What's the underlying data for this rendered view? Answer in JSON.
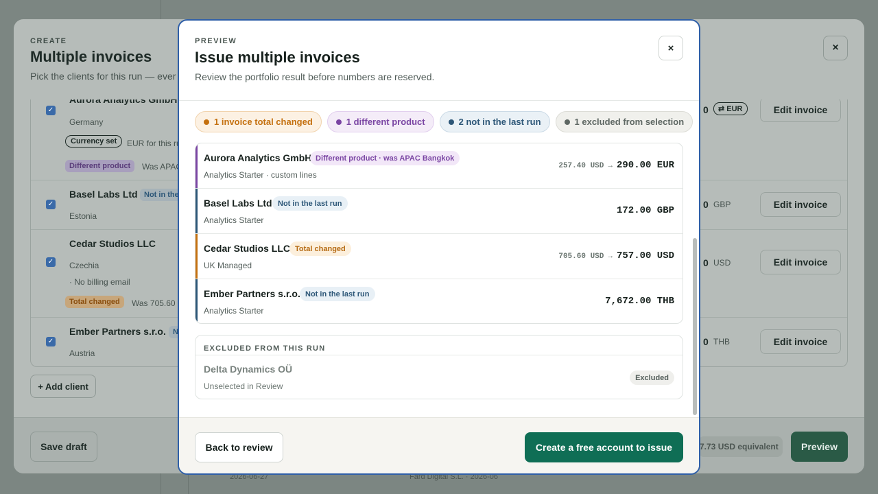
{
  "background_app": {
    "strip_date": "2026-06-27",
    "strip_text": "Fard Digital S.L. · 2026-06"
  },
  "back_modal": {
    "eyebrow": "CREATE",
    "title": "Multiple invoices",
    "subtitle": "Pick the clients for this run — ever",
    "close_icon": "×",
    "rows": [
      {
        "name": "Aurora Analytics GmbH",
        "country": "Germany",
        "currency_tag": "Currency set",
        "currency_note": "EUR for this ru",
        "diff_tag": "Different product",
        "diff_note": "Was APAC",
        "amount_frag": "0",
        "currency_badge": "⇄ EUR",
        "edit_label": "Edit invoice"
      },
      {
        "name": "Basel Labs Ltd",
        "badge": "Not in the",
        "country": "Estonia",
        "amount_frag": "0",
        "currency": "GBP",
        "edit_label": "Edit invoice"
      },
      {
        "name": "Cedar Studios LLC",
        "country": "Czechia",
        "note": "· No billing email",
        "diff_tag": "Total changed",
        "diff_note": "Was 705.60 U",
        "amount_frag": "0",
        "currency": "USD",
        "edit_label": "Edit invoice"
      },
      {
        "name": "Ember Partners s.r.o.",
        "badge": "N",
        "country": "Austria",
        "amount_frag": "0",
        "currency": "THB",
        "edit_label": "Edit invoice"
      }
    ],
    "add_client_label": "+ Add client",
    "save_draft_label": "Save draft",
    "equivalent_label": "7.73 USD equivalent",
    "preview_label": "Preview",
    "check_icon": "✓"
  },
  "preview_modal": {
    "eyebrow": "PREVIEW",
    "title": "Issue multiple invoices",
    "subtitle": "Review the portfolio result before numbers are reserved.",
    "close_icon": "×",
    "chips": [
      {
        "label": "1 invoice total changed",
        "color": "#c4700f",
        "bg": "#fcf1e3",
        "border": "#f1d3ad"
      },
      {
        "label": "1 different product",
        "color": "#7a45a3",
        "bg": "#f4ecf8",
        "border": "#e2cfee"
      },
      {
        "label": "2 not in the last run",
        "color": "#2c5677",
        "bg": "#eaf1f6",
        "border": "#cbdae6"
      },
      {
        "label": "1 excluded from selection",
        "color": "#5e6763",
        "bg": "#f0f0ec",
        "border": "#dcdcd6"
      }
    ],
    "invoices": [
      {
        "name": "Aurora Analytics GmbH",
        "badge": "Different product · was APAC Bangkok",
        "badge_color": "#7a45a3",
        "badge_bg": "#f2e7f8",
        "bar_color": "#7a45a3",
        "plan": "Analytics Starter · custom lines",
        "was": "257.40 USD",
        "arrow": "→",
        "now": "290.00 EUR"
      },
      {
        "name": "Basel Labs Ltd",
        "badge": "Not in the last run",
        "badge_color": "#2c5677",
        "badge_bg": "#e8f0f6",
        "bar_color": "#2c5677",
        "plan": "Analytics Starter",
        "was": "",
        "arrow": "",
        "now": "172.00 GBP"
      },
      {
        "name": "Cedar Studios LLC",
        "badge": "Total changed",
        "badge_color": "#b56a12",
        "badge_bg": "#fcefdc",
        "bar_color": "#c4700f",
        "plan": "UK Managed",
        "was": "705.60 USD",
        "arrow": "→",
        "now": "757.00 USD"
      },
      {
        "name": "Ember Partners s.r.o.",
        "badge": "Not in the last run",
        "badge_color": "#2c5677",
        "badge_bg": "#e8f0f6",
        "bar_color": "#2c5677",
        "plan": "Analytics Starter",
        "was": "",
        "arrow": "",
        "now": "7,672.00 THB"
      }
    ],
    "excluded": {
      "heading": "EXCLUDED FROM THIS RUN",
      "name": "Delta Dynamics OÜ",
      "reason": "Unselected in Review",
      "tag": "Excluded"
    },
    "back_label": "Back to review",
    "issue_label": "Create a free account to issue"
  }
}
